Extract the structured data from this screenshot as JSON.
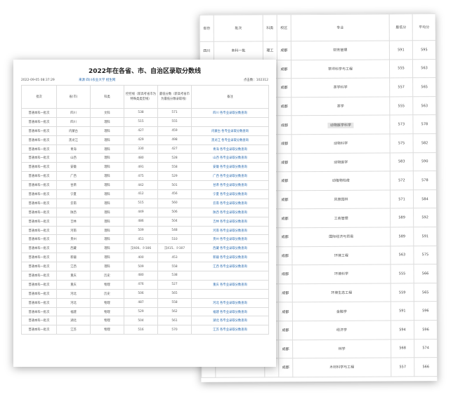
{
  "back_table": {
    "headers": [
      "省份",
      "批次",
      "科类",
      "校区",
      "专业",
      "最低分",
      "平均分"
    ],
    "rows": [
      {
        "province": "四川",
        "batch": "本科一批",
        "subject": "理工",
        "campus": "成都",
        "major": "财务管理",
        "min": "591",
        "avg": "595",
        "highlight": false
      },
      {
        "province": "",
        "batch": "",
        "subject": "",
        "campus": "成都",
        "major": "草坪科学与工程",
        "min": "555",
        "avg": "563",
        "highlight": false
      },
      {
        "province": "",
        "batch": "",
        "subject": "",
        "campus": "成都",
        "major": "茶学科学",
        "min": "557",
        "avg": "565",
        "highlight": false
      },
      {
        "province": "",
        "batch": "",
        "subject": "",
        "campus": "成都",
        "major": "茶学",
        "min": "555",
        "avg": "563",
        "highlight": false
      },
      {
        "province": "",
        "batch": "",
        "subject": "",
        "campus": "成都",
        "major": "动物医学科学",
        "min": "573",
        "avg": "578",
        "highlight": true
      },
      {
        "province": "",
        "batch": "",
        "subject": "",
        "campus": "成都",
        "major": "动物科学",
        "min": "575",
        "avg": "582",
        "highlight": false
      },
      {
        "province": "",
        "batch": "",
        "subject": "",
        "campus": "成都",
        "major": "动物医学",
        "min": "583",
        "avg": "590",
        "highlight": false
      },
      {
        "province": "",
        "batch": "",
        "subject": "",
        "campus": "成都",
        "major": "动植物检疫",
        "min": "572",
        "avg": "578",
        "highlight": false
      },
      {
        "province": "",
        "batch": "",
        "subject": "",
        "campus": "成都",
        "major": "风景园林",
        "min": "571",
        "avg": "584",
        "highlight": false
      },
      {
        "province": "",
        "batch": "",
        "subject": "",
        "campus": "成都",
        "major": "工商管理",
        "min": "589",
        "avg": "592",
        "highlight": false
      },
      {
        "province": "",
        "batch": "",
        "subject": "",
        "campus": "成都",
        "major": "国际经济与贸易",
        "min": "589",
        "avg": "591",
        "highlight": false
      },
      {
        "province": "",
        "batch": "",
        "subject": "",
        "campus": "成都",
        "major": "环境工程",
        "min": "563",
        "avg": "575",
        "highlight": false
      },
      {
        "province": "",
        "batch": "",
        "subject": "",
        "campus": "成都",
        "major": "环境科学",
        "min": "555",
        "avg": "566",
        "highlight": false
      },
      {
        "province": "",
        "batch": "",
        "subject": "",
        "campus": "成都",
        "major": "环境生态工程",
        "min": "559",
        "avg": "565",
        "highlight": false
      },
      {
        "province": "",
        "batch": "",
        "subject": "",
        "campus": "成都",
        "major": "金融学",
        "min": "591",
        "avg": "596",
        "highlight": false
      },
      {
        "province": "",
        "batch": "",
        "subject": "",
        "campus": "成都",
        "major": "经济学",
        "min": "594",
        "avg": "596",
        "highlight": false
      },
      {
        "province": "",
        "batch": "",
        "subject": "",
        "campus": "成都",
        "major": "林学",
        "min": "568",
        "avg": "574",
        "highlight": false
      },
      {
        "province": "",
        "batch": "",
        "subject": "",
        "campus": "成都",
        "major": "木材科学与工程",
        "min": "557",
        "avg": "566",
        "highlight": false
      }
    ]
  },
  "front": {
    "title": "2022年在各省、市、自治区录取分数线",
    "date": "2022-09-05 08:37:29",
    "source": "来源  四川农业大学 招生网",
    "clicks": "点击数：102312",
    "headers": [
      "批次",
      "省(市)",
      "科类",
      "控控线（新高考省市为特殊类类型线）",
      "最低分数（新高考省市为最低分数录取线）",
      "备注"
    ],
    "rows": [
      {
        "batch": "普通本科一批次",
        "prov": "四川",
        "subj": "文科",
        "ctrl": "538",
        "min": "571",
        "note": "四川 各专业录取分数查询"
      },
      {
        "batch": "普通本科一批次",
        "prov": "四川",
        "subj": "理科",
        "ctrl": "515",
        "min": "555",
        "note": ""
      },
      {
        "batch": "普通本科一批次",
        "prov": "内蒙古",
        "subj": "理科",
        "ctrl": "427",
        "min": "459",
        "note": "内蒙古 各专业录取分数查询"
      },
      {
        "batch": "普通本科一批次",
        "prov": "黑龙江",
        "subj": "理科",
        "ctrl": "429",
        "min": "498",
        "note": "黑龙江 各专业录取分数查询"
      },
      {
        "batch": "普通本科一批次",
        "prov": "青海",
        "subj": "理科",
        "ctrl": "330",
        "min": "427",
        "note": "青海 各专业录取分数查询"
      },
      {
        "batch": "普通本科一批次",
        "prov": "山西",
        "subj": "理科",
        "ctrl": "480",
        "min": "528",
        "note": "山西 各专业录取分数查询"
      },
      {
        "batch": "普通本科一批次",
        "prov": "安徽",
        "subj": "理科",
        "ctrl": "491",
        "min": "558",
        "note": "安徽 各专业录取分数查询"
      },
      {
        "batch": "普通本科一批次",
        "prov": "广西",
        "subj": "理科",
        "ctrl": "475",
        "min": "529",
        "note": "广西 各专业录取分数查询"
      },
      {
        "batch": "普通本科一批次",
        "prov": "甘肃",
        "subj": "理科",
        "ctrl": "442",
        "min": "501",
        "note": "甘肃 各专业录取分数查询"
      },
      {
        "batch": "普通本科一批次",
        "prov": "宁夏",
        "subj": "理科",
        "ctrl": "412",
        "min": "456",
        "note": "宁夏 各专业录取分数查询"
      },
      {
        "batch": "普通本科一批次",
        "prov": "云南",
        "subj": "理科",
        "ctrl": "515",
        "min": "560",
        "note": "云南 各专业录取分数查询"
      },
      {
        "batch": "普通本科一批次",
        "prov": "陕西",
        "subj": "理科",
        "ctrl": "449",
        "min": "506",
        "note": "陕西 各专业录取分数查询"
      },
      {
        "batch": "普通本科一批次",
        "prov": "吉林",
        "subj": "理科",
        "ctrl": "486",
        "min": "504",
        "note": "吉林 各专业录取分数查询"
      },
      {
        "batch": "普通本科一批次",
        "prov": "河南",
        "subj": "理科",
        "ctrl": "509",
        "min": "548",
        "note": "河南 各专业录取分数查询"
      },
      {
        "batch": "普通本科一批次",
        "prov": "贵州",
        "subj": "理科",
        "ctrl": "451",
        "min": "510",
        "note": "贵州 各专业录取分数查询"
      },
      {
        "batch": "普通本科一批次",
        "prov": "西藏",
        "subj": "理科",
        "ctrl": "汉400、少306",
        "min": "汉415、少307",
        "note": "西藏 各专业录取分数查询"
      },
      {
        "batch": "普通本科一批次",
        "prov": "新疆",
        "subj": "理科",
        "ctrl": "400",
        "min": "453",
        "note": "新疆 各专业录取分数查询"
      },
      {
        "batch": "普通本科一批次",
        "prov": "江西",
        "subj": "理科",
        "ctrl": "509",
        "min": "558",
        "note": "江西 各专业录取分数查询"
      },
      {
        "batch": "普通本科一批次",
        "prov": "重庆",
        "subj": "历史",
        "ctrl": "480",
        "min": "538",
        "note": ""
      },
      {
        "batch": "普通本科一批次",
        "prov": "重庆",
        "subj": "物理",
        "ctrl": "476",
        "min": "527",
        "note": "重庆 各专业录取分数查询"
      },
      {
        "batch": "普通本科一批次",
        "prov": "河北",
        "subj": "历史",
        "ctrl": "506",
        "min": "565",
        "note": ""
      },
      {
        "batch": "普通本科一批次",
        "prov": "河北",
        "subj": "物理",
        "ctrl": "487",
        "min": "558",
        "note": "河北 各专业录取分数查询"
      },
      {
        "batch": "普通本科一批次",
        "prov": "福建",
        "subj": "物理",
        "ctrl": "529",
        "min": "562",
        "note": "福建 各专业录取分数查询"
      },
      {
        "batch": "普通本科一批次",
        "prov": "湖北",
        "subj": "物理",
        "ctrl": "504",
        "min": "561",
        "note": "湖北 各专业录取分数查询"
      },
      {
        "batch": "普通本科一批次",
        "prov": "江苏",
        "subj": "物理",
        "ctrl": "516",
        "min": "570",
        "note": "江苏 各专业录取分数查询"
      }
    ]
  }
}
